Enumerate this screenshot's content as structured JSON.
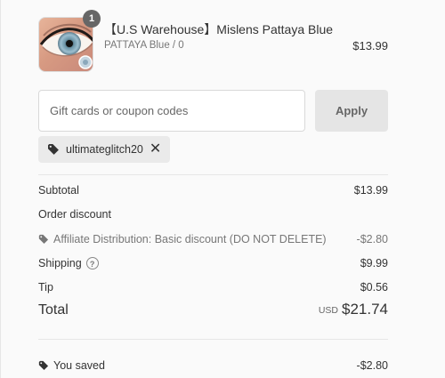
{
  "product": {
    "title": "【U.S Warehouse】Mislens Pattaya Blue",
    "variant": "PATTAYA Blue / 0",
    "price": "$13.99",
    "quantity": "1",
    "image_icon": "contact-lens-eye-image"
  },
  "discount": {
    "placeholder": "Gift cards or coupon codes",
    "apply_label": "Apply",
    "applied_code": "ultimateglitch20",
    "tag_icon": "tag-icon",
    "remove_icon": "close-icon"
  },
  "summary": {
    "subtotal_label": "Subtotal",
    "subtotal_value": "$13.99",
    "order_discount_label": "Order discount",
    "discount_detail_label": "Affiliate Distribution: Basic discount (DO NOT DELETE)",
    "discount_detail_value": "-$2.80",
    "shipping_label": "Shipping",
    "shipping_value": "$9.99",
    "tip_label": "Tip",
    "tip_value": "$0.56",
    "total_label": "Total",
    "total_currency": "USD",
    "total_value": "$21.74",
    "you_saved_label": "You saved",
    "you_saved_value": "-$2.80"
  },
  "colors": {
    "background": "#fafafa",
    "text": "#333333",
    "muted": "#777777",
    "button": "#e5e5e5"
  }
}
